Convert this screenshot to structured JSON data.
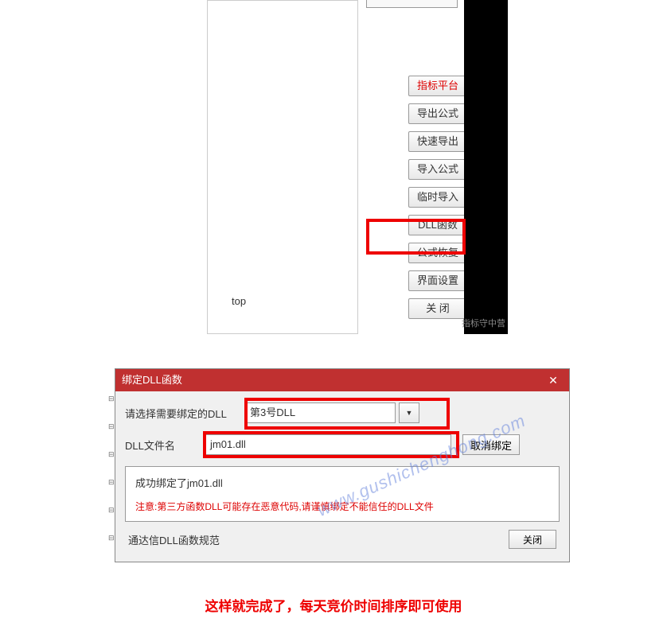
{
  "screenshot1": {
    "partial_top_text": "",
    "left_text": "top",
    "watermark": "指标守中营",
    "buttons": {
      "indicator_platform": "指标平台",
      "export_formula": "导出公式",
      "quick_export": "快速导出",
      "import_formula": "导入公式",
      "temp_import": "临时导入",
      "dll_function": "DLL函数",
      "formula_restore": "公式恢复",
      "ui_settings": "界面设置",
      "close": "关 闭"
    }
  },
  "dialog": {
    "title": "绑定DLL函数",
    "label_select": "请选择需要绑定的DLL",
    "select_value": "第3号DLL",
    "label_file": "DLL文件名",
    "file_value": "jm01.dll",
    "cancel_bind": "取消绑定",
    "success_msg": "成功绑定了jm01.dll",
    "warning_msg": "注意:第三方函数DLL可能存在恶意代码,请谨慎绑定不能信任的DLL文件",
    "spec_link": "通达信DLL函数规范",
    "close_btn": "关闭"
  },
  "bottom_text": "这样就完成了，每天竞价时间排序即可使用",
  "watermark_url": "www.gushichenghong.com"
}
